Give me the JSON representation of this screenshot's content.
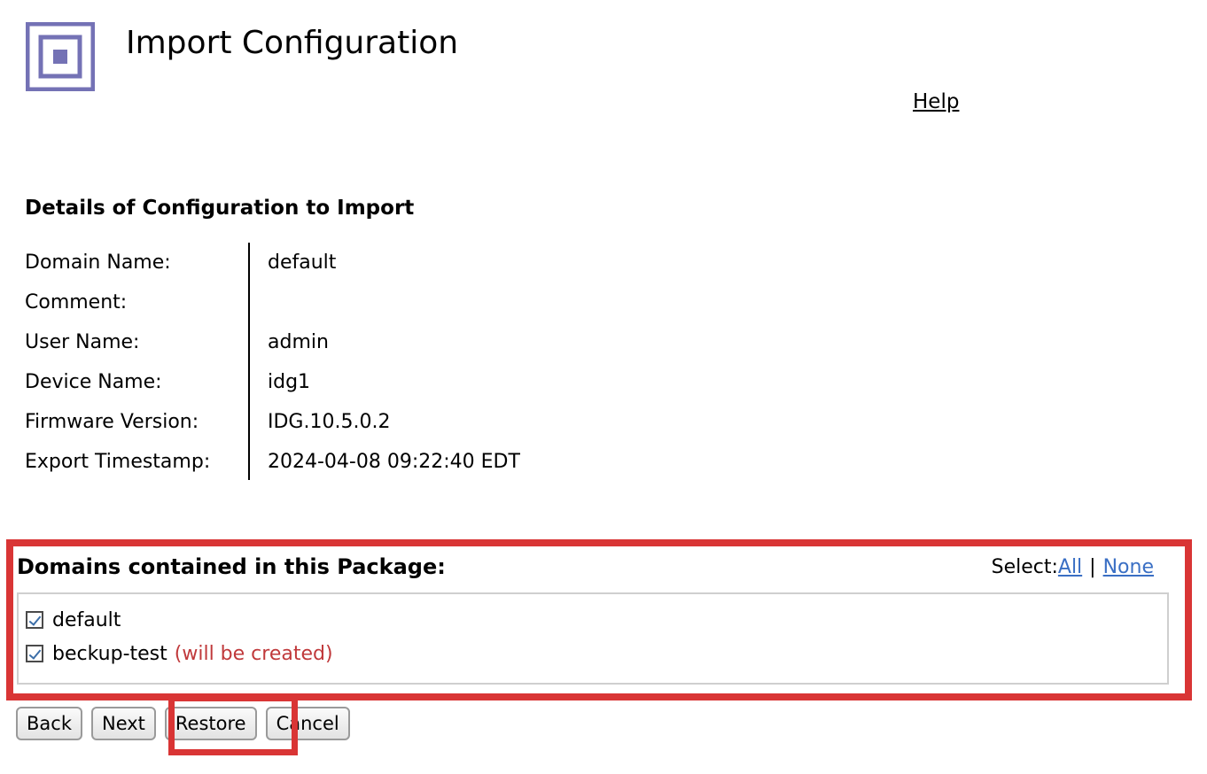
{
  "page": {
    "title": "Import Configuration",
    "help_label": "Help"
  },
  "details": {
    "heading": "Details of Configuration to Import",
    "rows": [
      {
        "label": "Domain Name:",
        "value": "default"
      },
      {
        "label": "Comment:",
        "value": ""
      },
      {
        "label": "User Name:",
        "value": "admin"
      },
      {
        "label": "Device Name:",
        "value": "idg1"
      },
      {
        "label": "Firmware Version:",
        "value": "IDG.10.5.0.2"
      },
      {
        "label": "Export Timestamp:",
        "value": "2024-04-08 09:22:40 EDT"
      }
    ]
  },
  "domains": {
    "heading": "Domains contained in this Package:",
    "select_label": "Select:",
    "select_all": "All",
    "select_sep": "|",
    "select_none": "None",
    "items": [
      {
        "name": "default",
        "checked": true,
        "note": ""
      },
      {
        "name": "beckup-test",
        "checked": true,
        "note": "(will be created)"
      }
    ]
  },
  "buttons": {
    "back": "Back",
    "next": "Next",
    "restore": "Restore",
    "cancel": "Cancel"
  },
  "colors": {
    "logo": "#7472b5",
    "highlight": "#d93535",
    "link": "#3a6fc4",
    "created_note": "#c0393b"
  },
  "icons": {
    "logo": "square-target-icon",
    "checkbox": "checkmark-icon"
  }
}
